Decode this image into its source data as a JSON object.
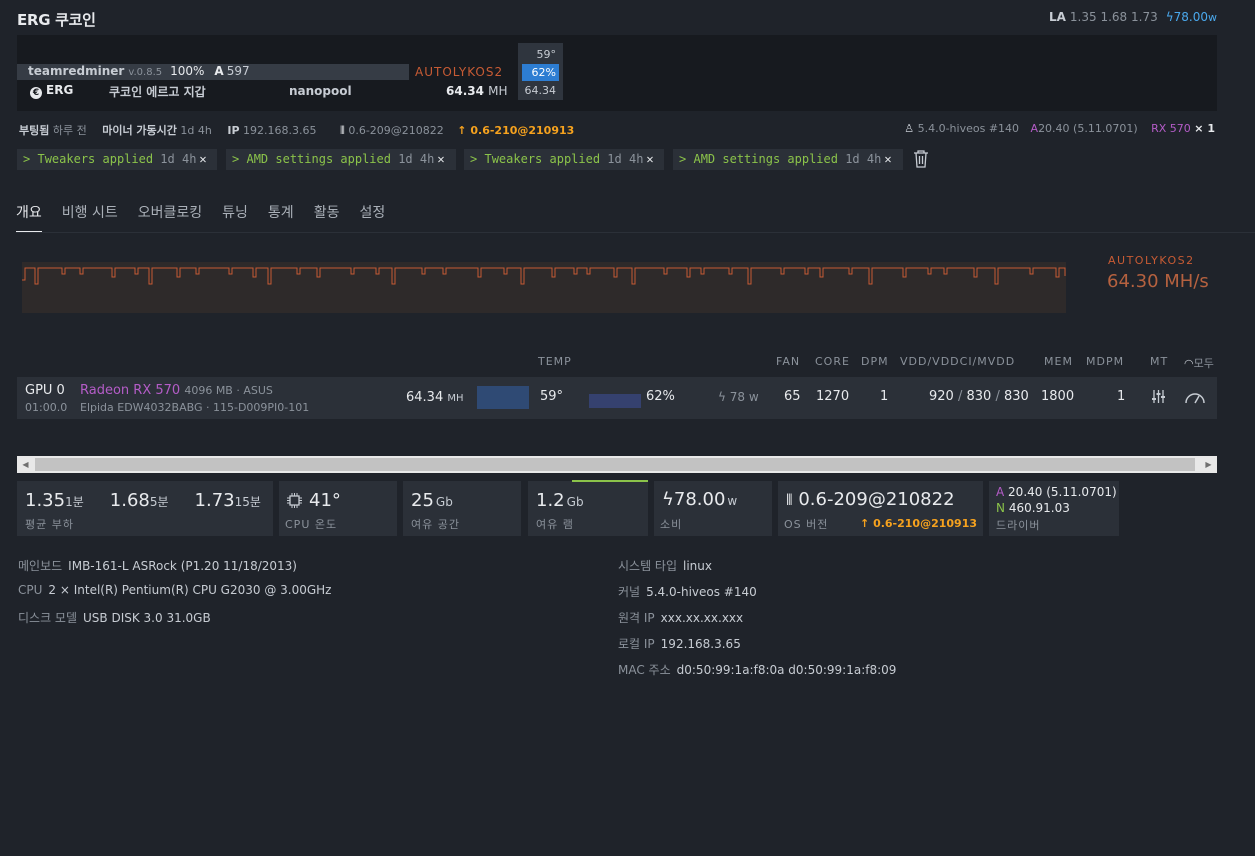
{
  "header": {
    "title": "ERG 쿠코인",
    "la_label": "LA",
    "la_values": "1.35 1.68 1.73",
    "power": "78.00",
    "power_unit": "w"
  },
  "miner": {
    "name": "teamredminer",
    "version": "v.0.8.5",
    "percent": "100%",
    "accepted_label": "A",
    "accepted": "597",
    "algo": "AUTOLYKOS2",
    "coin": "ERG",
    "wallet": "쿠코인 에르고 지갑",
    "pool": "nanopool",
    "hashrate": "64.34",
    "hash_unit": "MH",
    "mini_temp": "59°",
    "mini_fan": "62%",
    "mini_hash": "64.34"
  },
  "info": {
    "boot_label": "부팅됨",
    "boot_value": "하루 전",
    "uptime_label": "마이너 가동시간",
    "uptime_value": "1d 4h",
    "ip_label": "IP",
    "ip_value": "192.168.3.65",
    "version": "0.6-209@210822",
    "update": "0.6-210@210913",
    "kernel": "5.4.0-hiveos #140",
    "amd_label": "A",
    "amd_driver": "20.40 (5.11.0701)",
    "gpu_model": "RX 570",
    "gpu_count": "× 1"
  },
  "tags": [
    {
      "text": "Tweakers applied",
      "ago": "1d 4h"
    },
    {
      "text": "AMD settings applied",
      "ago": "1d 4h"
    },
    {
      "text": "Tweakers applied",
      "ago": "1d 4h"
    },
    {
      "text": "AMD settings applied",
      "ago": "1d 4h"
    }
  ],
  "tabs": [
    "개요",
    "비행 시트",
    "오버클로킹",
    "튜닝",
    "통계",
    "활동",
    "설정"
  ],
  "chart": {
    "algo": "AUTOLYKOS2",
    "hashrate": "64.30 MH/s"
  },
  "gpu_table": {
    "headers": {
      "temp": "TEMP",
      "fan": "FAN",
      "core": "CORE",
      "dpm": "DPM",
      "vdd": "VDD/VDDCI/MVDD",
      "mem": "MEM",
      "mdpm": "MDPM",
      "mt": "MT",
      "tune": "모두"
    },
    "row": {
      "name": "GPU 0",
      "bus": "01:00.0",
      "model": "Radeon RX 570",
      "vram": "4096 MB · ASUS",
      "memory": "Elpida EDW4032BABG · 115-D009PI0-101",
      "hash": "64.34",
      "hash_unit": "MH",
      "temp": "59°",
      "fan_pct": "62%",
      "power": "78",
      "power_unit": "w",
      "fan": "65",
      "core": "1270",
      "dpm": "1",
      "vdd": "920",
      "vddci": "830",
      "mvdd": "830",
      "mem": "1800",
      "mdpm": "1"
    }
  },
  "cards": {
    "load1": "1.35",
    "load1_unit": "1분",
    "load5": "1.68",
    "load5_unit": "5분",
    "load15": "1.73",
    "load15_unit": "15분",
    "load_label": "평균 부하",
    "cpu_temp": "41°",
    "cpu_temp_label": "CPU 온도",
    "disk": "25",
    "disk_unit": "Gb",
    "disk_label": "여유 공간",
    "ram": "1.2",
    "ram_unit": "Gb",
    "ram_label": "여유 램",
    "power": "78.00",
    "power_unit": "w",
    "power_label": "소비",
    "os": "0.6-209@210822",
    "os_label": "OS 버전",
    "os_update": "0.6-210@210913",
    "drv_a_label": "A",
    "drv_a": "20.40 (5.11.0701)",
    "drv_n_label": "N",
    "drv_n": "460.91.03",
    "drv_label": "드라이버"
  },
  "details_left": [
    {
      "k": "메인보드",
      "v": "IMB-161-L ASRock (P1.20 11/18/2013)"
    },
    {
      "k": "CPU",
      "v": "2 × Intel(R) Pentium(R) CPU G2030 @ 3.00GHz"
    },
    {
      "k": "디스크 모델",
      "v": "USB DISK 3.0 31.0GB"
    }
  ],
  "details_right": [
    {
      "k": "시스템 타입",
      "v": "linux"
    },
    {
      "k": "커널",
      "v": "5.4.0-hiveos #140"
    },
    {
      "k": "원격 IP",
      "v": "xxx.xx.xx.xxx"
    },
    {
      "k": "로컬 IP",
      "v": "192.168.3.65"
    },
    {
      "k": "MAC 주소",
      "v": "d0:50:99:1a:f8:0a d0:50:99:1a:f8:09"
    }
  ],
  "colors": {
    "accent": "#4aa8ec",
    "algo": "#c75b34",
    "ok": "#8bc34a",
    "update": "#f6a21e",
    "amd": "#b45cc7"
  }
}
